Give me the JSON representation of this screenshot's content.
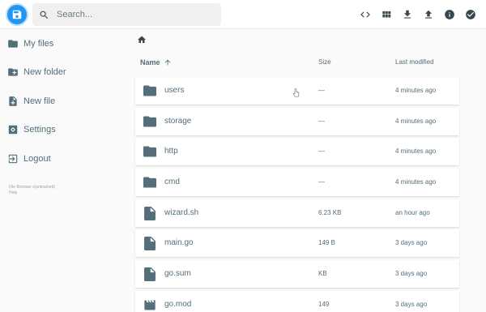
{
  "header": {
    "search_placeholder": "Search...",
    "actions": [
      {
        "name": "code-view-icon",
        "label": "toggle view"
      },
      {
        "name": "grid-view-icon",
        "label": "switch view"
      },
      {
        "name": "download-icon",
        "label": "download"
      },
      {
        "name": "upload-icon",
        "label": "upload"
      },
      {
        "name": "info-icon",
        "label": "info"
      },
      {
        "name": "select-check-icon",
        "label": "select"
      }
    ]
  },
  "sidebar": {
    "items": [
      {
        "label": "My files",
        "icon": "folder-icon"
      },
      {
        "label": "New folder",
        "icon": "create-folder-icon"
      },
      {
        "label": "New file",
        "icon": "note-add-icon"
      },
      {
        "label": "Settings",
        "icon": "settings-icon"
      },
      {
        "label": "Logout",
        "icon": "logout-icon"
      }
    ],
    "credits": [
      "File Browser v(untracked)",
      "Help"
    ]
  },
  "listing": {
    "columns": {
      "name": "Name",
      "size": "Size",
      "modified": "Last modified"
    },
    "rows": [
      {
        "name": "users",
        "type": "folder",
        "size": "—",
        "modified": "4 minutes ago"
      },
      {
        "name": "storage",
        "type": "folder",
        "size": "—",
        "modified": "4 minutes ago"
      },
      {
        "name": "http",
        "type": "folder",
        "size": "—",
        "modified": "4 minutes ago"
      },
      {
        "name": "cmd",
        "type": "folder",
        "size": "—",
        "modified": "4 minutes ago"
      },
      {
        "name": "wizard.sh",
        "type": "file",
        "size": "6.23 KB",
        "modified": "an hour ago"
      },
      {
        "name": "main.go",
        "type": "file",
        "size": "149 B",
        "modified": "3 days ago"
      },
      {
        "name": "go.sum",
        "type": "file",
        "size": "KB",
        "modified": "3 days ago"
      },
      {
        "name": "go.mod",
        "type": "file",
        "size": "149",
        "modified": "3 days ago"
      }
    ]
  },
  "colors": {
    "accent": "#2196f3",
    "text": "#546e7a",
    "icon": "#546e7a",
    "background": "#fafafa"
  }
}
